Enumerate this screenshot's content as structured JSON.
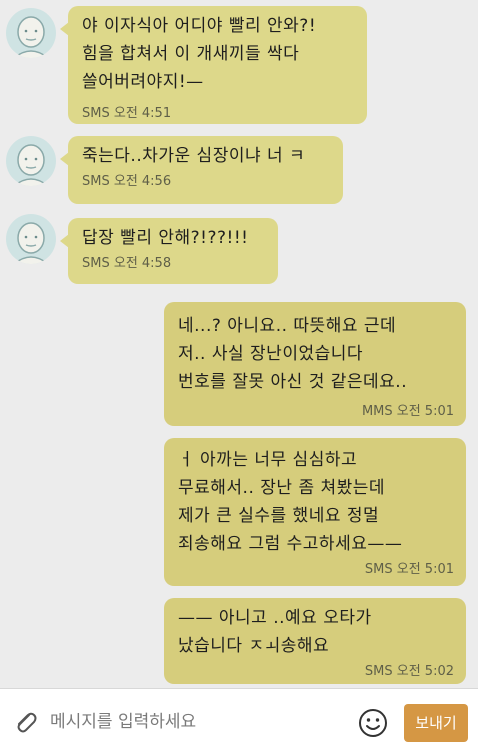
{
  "messages": [
    {
      "text": "야 이자식아 어디야 빨리 안와?!\n힘을 합쳐서 이 개새끼들 싹다\n쓸어버려야지!—",
      "meta": "SMS 오전 4:51"
    },
    {
      "text": "죽는다..차가운 심장이냐 너 ㅋ",
      "meta": "SMS 오전 4:56"
    },
    {
      "text": "답장 빨리  안해?!??!!!",
      "meta": "SMS 오전 4:58"
    },
    {
      "text": "네...? 아니요.. 따뜻해요 근데\n저.. 사실 장난이었습니다\n번호를 잘못 아신 것 같은데요..",
      "meta": "MMS 오전 5:01"
    },
    {
      "text": "ㅓ 아까는 너무 심심하고\n무료해서.. 장난 좀 쳐봤는데\n제가 큰 실수를 했네요 정멀\n죄송해요 그럼 수고하세요——",
      "meta": "SMS 오전 5:01"
    },
    {
      "text": "—— 아니고 ..예요 오타가\n났습니다 ㅈㅚ송해요",
      "meta": "SMS 오전 5:02"
    }
  ],
  "input": {
    "placeholder": "메시지를 입력하세요"
  },
  "send_label": "보내기",
  "icons": {
    "attach": "paperclip-icon",
    "emoji": "smiley-icon",
    "avatar": "avatar-face-icon"
  },
  "colors": {
    "background": "#ececec",
    "incoming_bubble": "#ddd88a",
    "outgoing_bubble": "#d6cd7c",
    "send_button": "#d59744",
    "avatar_bg": "#cfe3e3"
  }
}
